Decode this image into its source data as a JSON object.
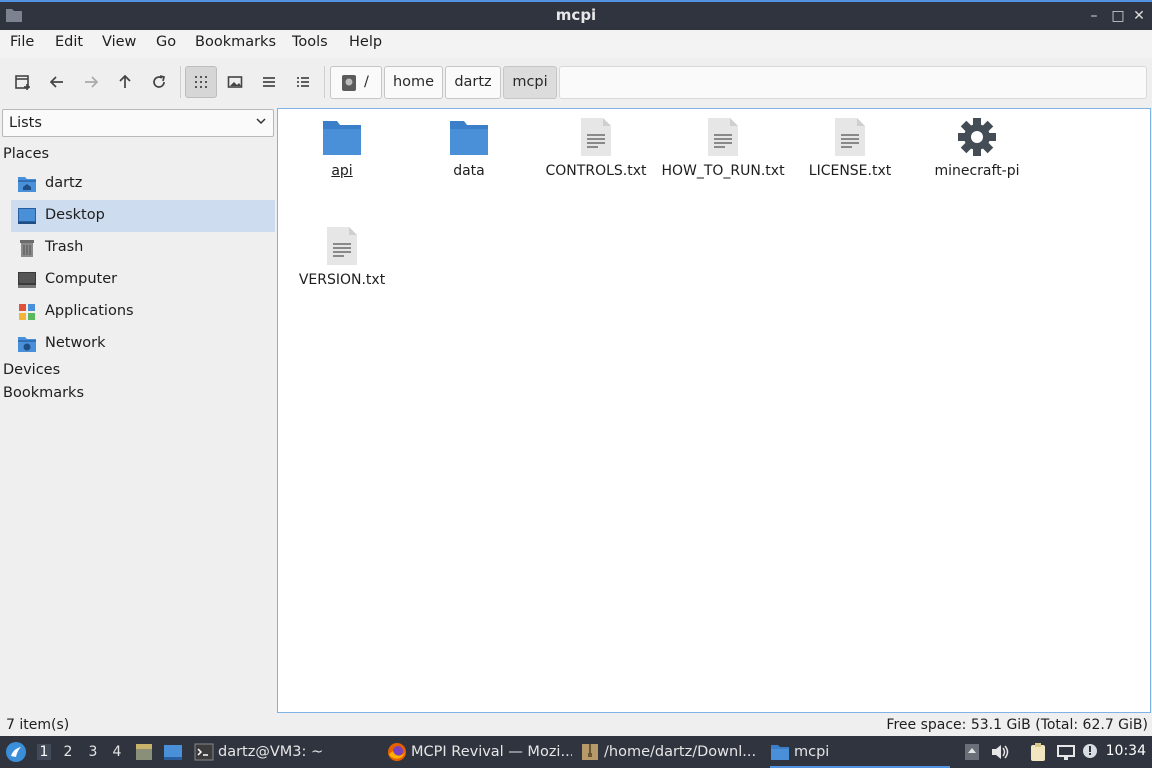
{
  "window": {
    "title": "mcpi",
    "controls": {
      "minimize": "–",
      "maximize": "□",
      "close": "✕"
    }
  },
  "menubar": [
    "File",
    "Edit",
    "View",
    "Go",
    "Bookmarks",
    "Tools",
    "Help"
  ],
  "toolbar": {
    "buttons": [
      "new-tab-icon",
      "back-icon",
      "forward-icon",
      "up-icon",
      "reload-icon",
      "icon-view-icon",
      "thumbnail-view-icon",
      "compact-view-icon",
      "detailed-list-view-icon"
    ],
    "active_view": "icon-view"
  },
  "breadcrumb": {
    "root": "/",
    "parts": [
      "home",
      "dartz",
      "mcpi"
    ]
  },
  "sidebar": {
    "selector": "Lists",
    "places_heading": "Places",
    "places": [
      {
        "label": "dartz",
        "icon": "home-folder-icon",
        "selected": false
      },
      {
        "label": "Desktop",
        "icon": "desktop-icon",
        "selected": true
      },
      {
        "label": "Trash",
        "icon": "trash-icon",
        "selected": false
      },
      {
        "label": "Computer",
        "icon": "computer-icon",
        "selected": false
      },
      {
        "label": "Applications",
        "icon": "applications-icon",
        "selected": false
      },
      {
        "label": "Network",
        "icon": "network-icon",
        "selected": false
      }
    ],
    "devices_heading": "Devices",
    "bookmarks_heading": "Bookmarks"
  },
  "files": [
    {
      "name": "api",
      "icon": "folder-icon"
    },
    {
      "name": "data",
      "icon": "folder-icon"
    },
    {
      "name": "CONTROLS.txt",
      "icon": "text-file-icon"
    },
    {
      "name": "HOW_TO_RUN.txt",
      "icon": "text-file-icon"
    },
    {
      "name": "LICENSE.txt",
      "icon": "text-file-icon"
    },
    {
      "name": "minecraft-pi",
      "icon": "executable-gear-icon"
    },
    {
      "name": "VERSION.txt",
      "icon": "text-file-icon"
    }
  ],
  "statusbar": {
    "items": "7 item(s)",
    "free_space": "Free space: 53.1 GiB (Total: 62.7 GiB)"
  },
  "taskbar": {
    "workspaces": [
      "1",
      "2",
      "3",
      "4"
    ],
    "active_workspace": "1",
    "tasks": [
      {
        "label": "dartz@VM3: ~",
        "icon": "terminal-icon"
      },
      {
        "label": "MCPI Revival — Mozi...",
        "icon": "firefox-icon"
      },
      {
        "label": "/home/dartz/Downl...",
        "icon": "archive-icon"
      },
      {
        "label": "mcpi",
        "icon": "folder-icon"
      }
    ],
    "clock": "10:34"
  },
  "colors": {
    "titlebar": "#2f343f",
    "accent": "#5294e2",
    "folder": "#4a90d9",
    "selection": "#cddcee"
  }
}
